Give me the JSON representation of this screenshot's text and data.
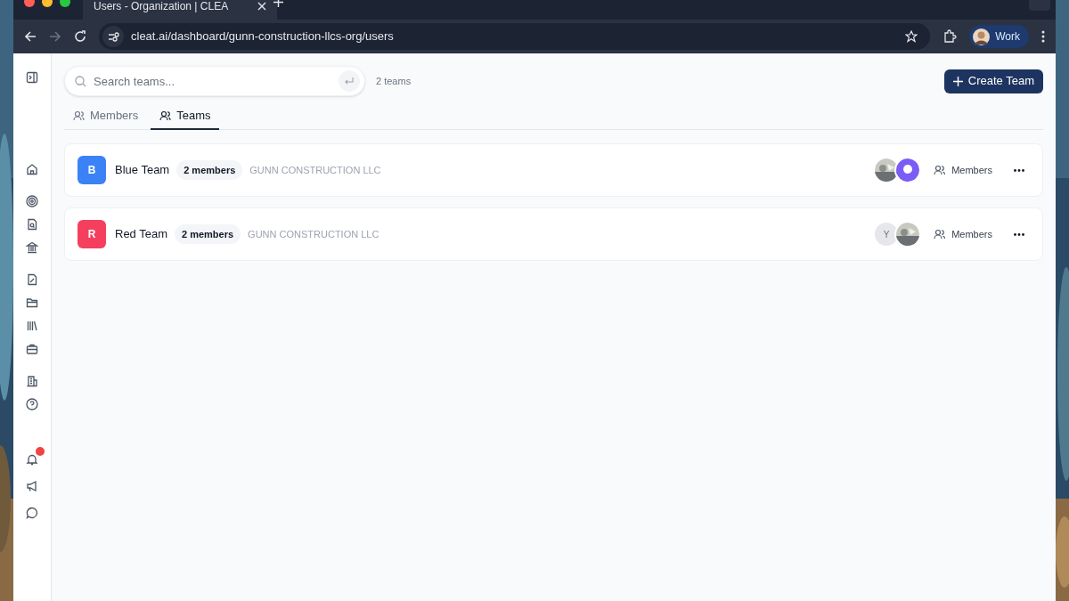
{
  "browser": {
    "tab_title": "Users - Organization | CLEA",
    "address": "cleat.ai/dashboard/gunn-construction-llcs-org/users",
    "profile": "Work"
  },
  "notifications": {
    "unread": true
  },
  "search": {
    "placeholder": "Search teams...",
    "count": "2 teams"
  },
  "create_button": "Create Team",
  "tabs": [
    {
      "label": "Members",
      "selected": false
    },
    {
      "label": "Teams",
      "selected": true
    }
  ],
  "teams": [
    {
      "initial": "B",
      "color": "#3b82f6",
      "name": "Blue Team",
      "members": "2 members",
      "organization": "GUNN CONSTRUCTION LLC",
      "avatars": [
        {
          "kind": "picture"
        },
        {
          "kind": "placeholder"
        }
      ],
      "action": "Members"
    },
    {
      "initial": "R",
      "color": "#f43f5e",
      "name": "Red Team",
      "members": "2 members",
      "organization": "GUNN CONSTRUCTION LLC",
      "avatars": [
        {
          "kind": "initial",
          "text": "Y"
        },
        {
          "kind": "picture"
        }
      ],
      "action": "Members"
    }
  ]
}
